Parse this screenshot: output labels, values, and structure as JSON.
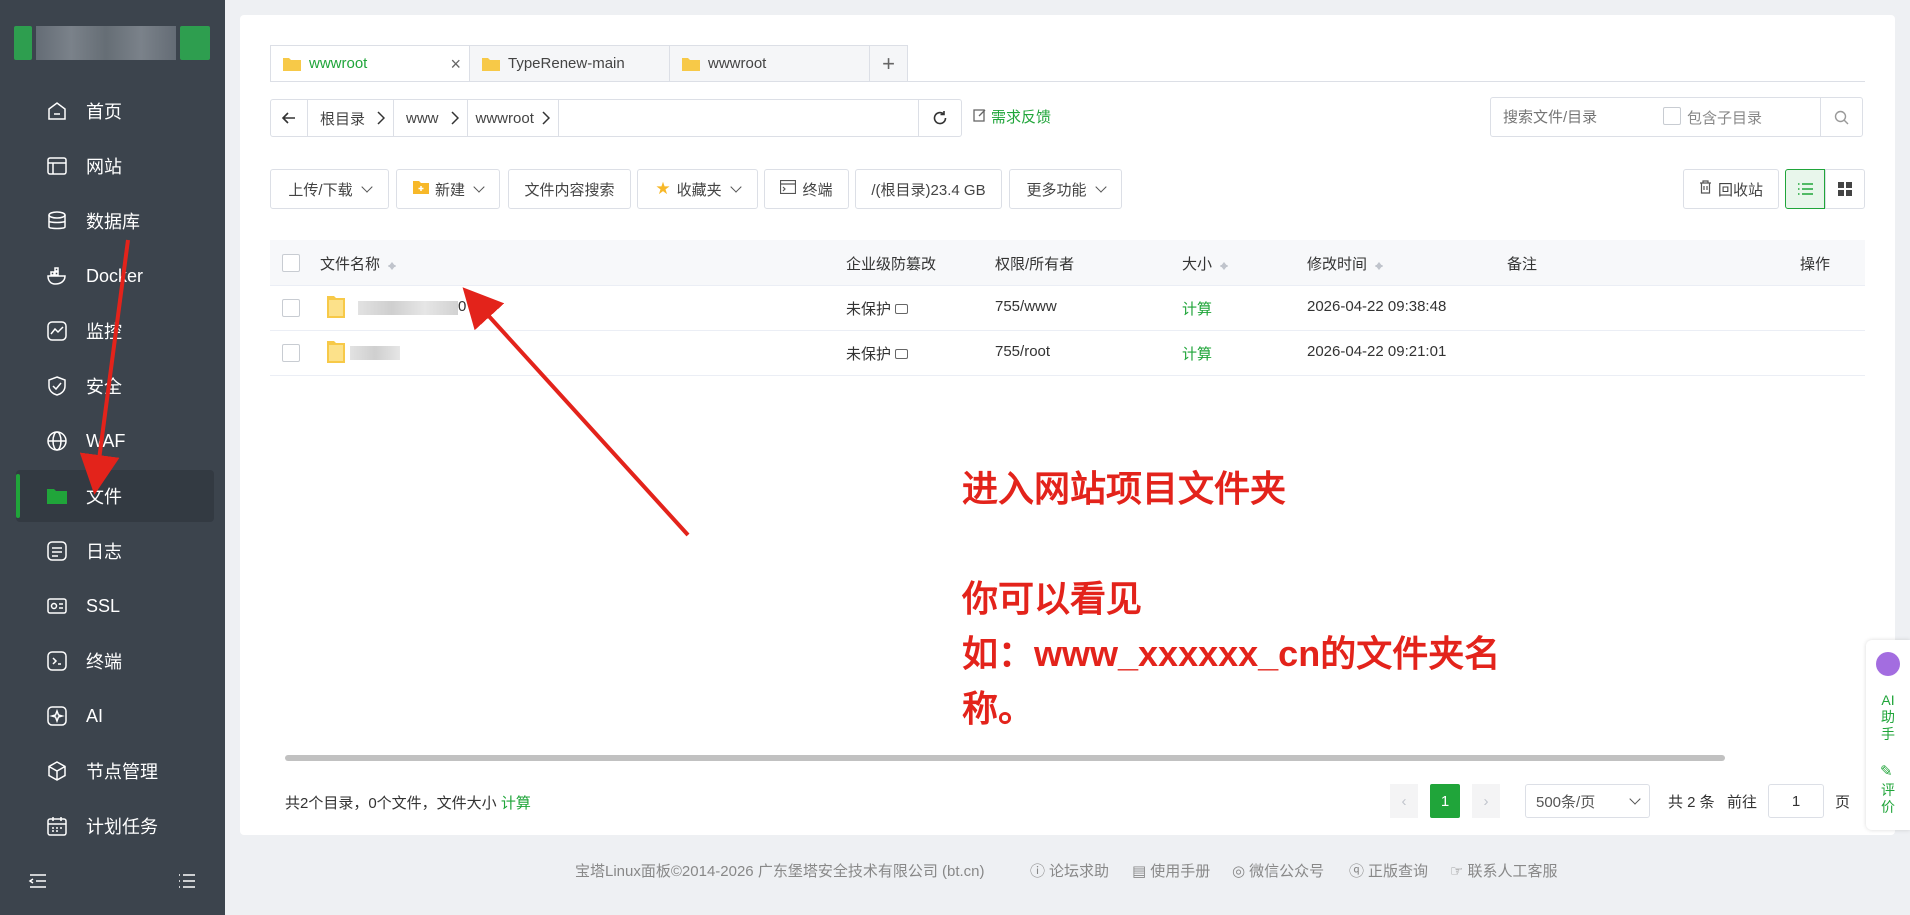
{
  "sidebar": {
    "items": [
      {
        "label": "首页",
        "icon": "home-icon"
      },
      {
        "label": "网站",
        "icon": "website-icon"
      },
      {
        "label": "数据库",
        "icon": "database-icon"
      },
      {
        "label": "Docker",
        "icon": "docker-icon"
      },
      {
        "label": "监控",
        "icon": "monitor-icon"
      },
      {
        "label": "安全",
        "icon": "shield-icon"
      },
      {
        "label": "WAF",
        "icon": "waf-icon"
      },
      {
        "label": "文件",
        "icon": "folder-icon"
      },
      {
        "label": "日志",
        "icon": "log-icon"
      },
      {
        "label": "SSL",
        "icon": "ssl-icon"
      },
      {
        "label": "终端",
        "icon": "terminal-icon"
      },
      {
        "label": "AI",
        "icon": "ai-icon"
      },
      {
        "label": "节点管理",
        "icon": "node-icon"
      },
      {
        "label": "计划任务",
        "icon": "calendar-icon"
      }
    ],
    "active_index": 7
  },
  "tabs": [
    {
      "label": "wwwroot",
      "active": true
    },
    {
      "label": "TypeRenew-main",
      "active": false
    },
    {
      "label": "wwwroot",
      "active": false
    }
  ],
  "tab_add": "+",
  "path": {
    "segments": [
      "根目录",
      "www",
      "wwwroot"
    ]
  },
  "feedback": "需求反馈",
  "search": {
    "placeholder": "搜索文件/目录",
    "include_sub": "包含子目录"
  },
  "toolbar": {
    "upload": "上传/下载",
    "new": "新建",
    "content_search": "文件内容搜索",
    "favorites": "收藏夹",
    "terminal": "终端",
    "disk": "/(根目录)23.4 GB",
    "more": "更多功能",
    "recycle": "回收站"
  },
  "table": {
    "headers": {
      "name": "文件名称",
      "protect": "企业级防篡改",
      "perm": "权限/所有者",
      "size": "大小",
      "mtime": "修改时间",
      "note": "备注",
      "ops": "操作"
    },
    "rows": [
      {
        "name_suffix": "0",
        "protect": "未保护",
        "perm": "755/www",
        "size": "计算",
        "mtime": "2026-04-22 09:38:48"
      },
      {
        "name_suffix": "",
        "protect": "未保护",
        "perm": "755/root",
        "size": "计算",
        "mtime": "2026-04-22 09:21:01"
      }
    ]
  },
  "summary": {
    "text": "共2个目录，0个文件，文件大小",
    "calc": "计算"
  },
  "pagination": {
    "current": "1",
    "per_page": "500条/页",
    "total": "共 2 条",
    "goto_label": "前往",
    "goto_value": "1",
    "page_unit": "页"
  },
  "annotation": {
    "line1": "进入网站项目文件夹",
    "line2": "你可以看见",
    "line3": "如：www_xxxxxx_cn的文件夹名",
    "line4": "称。"
  },
  "footer": {
    "copyright": "宝塔Linux面板©2014-2026 广东堡塔安全技术有限公司 (bt.cn)",
    "forum": "论坛求助",
    "manual": "使用手册",
    "wechat": "微信公众号",
    "verify": "正版查询",
    "contact": "联系人工客服"
  },
  "ai_panel": {
    "assistant": "AI助手",
    "review": "评价"
  },
  "colors": {
    "accent": "#20a53a",
    "sidebar": "#3c444d",
    "annotation": "#e3231b"
  }
}
